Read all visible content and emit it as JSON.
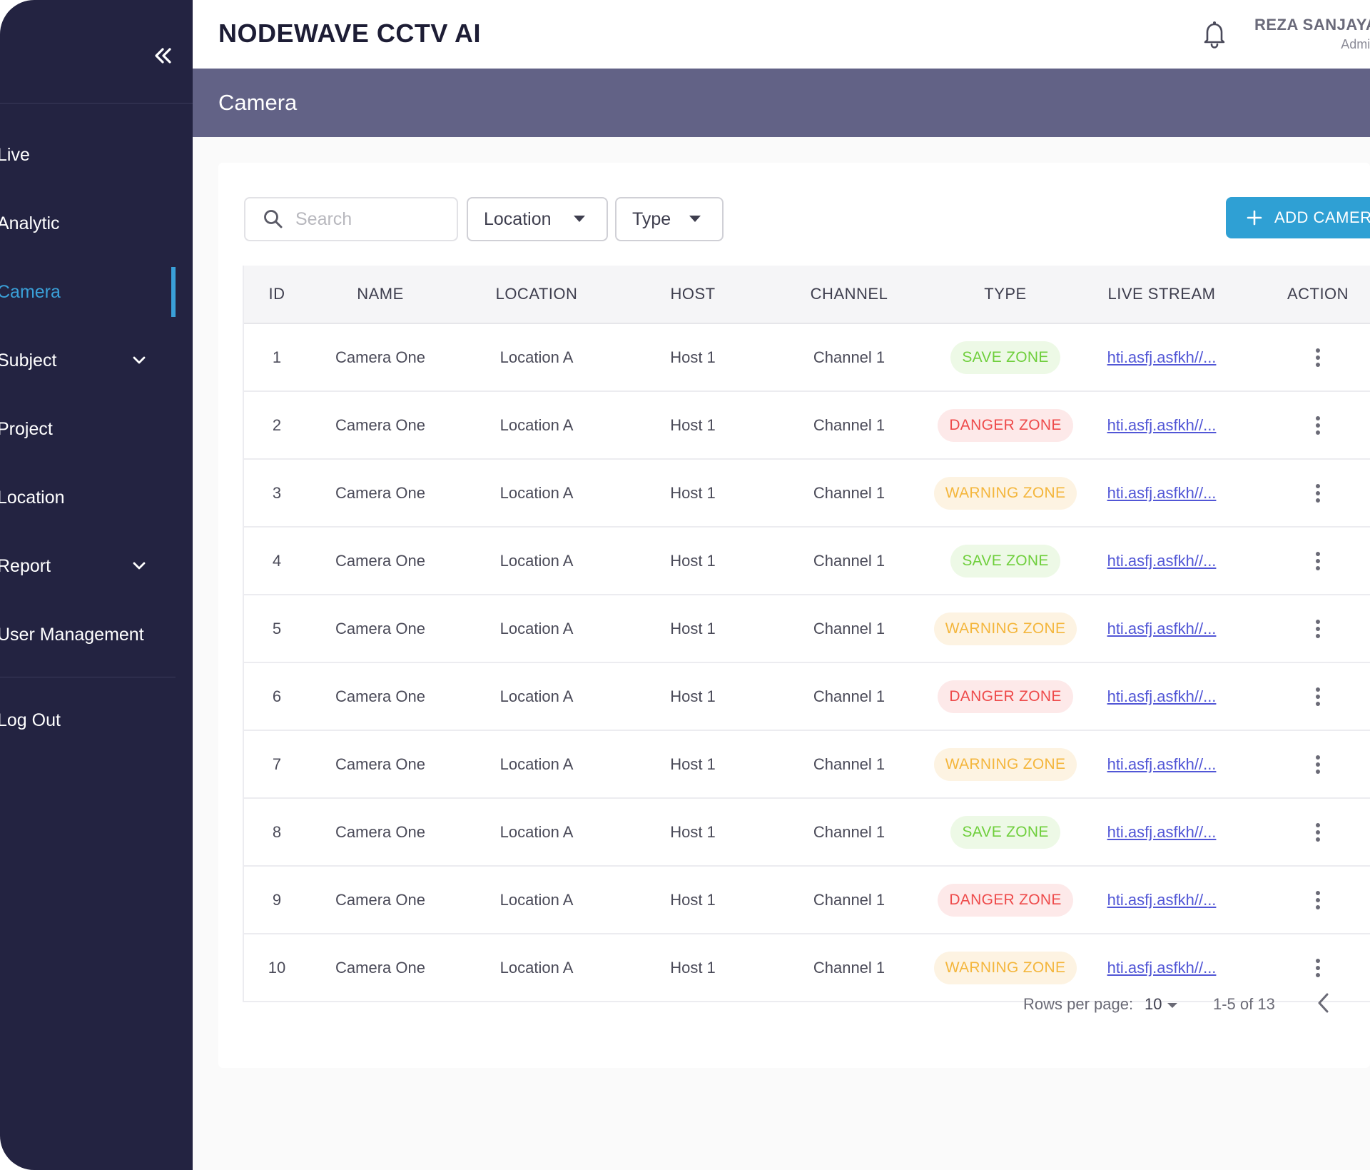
{
  "app": {
    "title": "NODEWAVE CCTV AI"
  },
  "user": {
    "name": "REZA SANJAYA",
    "role": "Admin"
  },
  "page": {
    "title": "Camera"
  },
  "sidebar": {
    "items": [
      {
        "label": "Live"
      },
      {
        "label": "Analytic"
      },
      {
        "label": "Camera",
        "active": true
      },
      {
        "label": "Subject",
        "has_submenu": true
      },
      {
        "label": "Project"
      },
      {
        "label": "Location"
      },
      {
        "label": "Report",
        "has_submenu": true
      },
      {
        "label": "User Management"
      }
    ],
    "logout": "Log Out"
  },
  "toolbar": {
    "search_placeholder": "Search",
    "location_filter": "Location",
    "type_filter": "Type",
    "add_button": "ADD CAMER"
  },
  "table": {
    "headers": [
      "ID",
      "NAME",
      "LOCATION",
      "HOST",
      "CHANNEL",
      "TYPE",
      "LIVE STREAM",
      "ACTION"
    ],
    "rows": [
      {
        "id": "1",
        "name": "Camera One",
        "location": "Location A",
        "host": "Host 1",
        "channel": "Channel 1",
        "type": "SAVE ZONE",
        "type_kind": "save",
        "stream": "hti.asfj.asfkh//..."
      },
      {
        "id": "2",
        "name": "Camera One",
        "location": "Location A",
        "host": "Host 1",
        "channel": "Channel 1",
        "type": "DANGER ZONE",
        "type_kind": "danger",
        "stream": "hti.asfj.asfkh//..."
      },
      {
        "id": "3",
        "name": "Camera One",
        "location": "Location A",
        "host": "Host 1",
        "channel": "Channel 1",
        "type": "WARNING ZONE",
        "type_kind": "warning",
        "stream": "hti.asfj.asfkh//..."
      },
      {
        "id": "4",
        "name": "Camera One",
        "location": "Location A",
        "host": "Host 1",
        "channel": "Channel 1",
        "type": "SAVE ZONE",
        "type_kind": "save",
        "stream": "hti.asfj.asfkh//..."
      },
      {
        "id": "5",
        "name": "Camera One",
        "location": "Location A",
        "host": "Host 1",
        "channel": "Channel 1",
        "type": "WARNING ZONE",
        "type_kind": "warning",
        "stream": "hti.asfj.asfkh//..."
      },
      {
        "id": "6",
        "name": "Camera One",
        "location": "Location A",
        "host": "Host 1",
        "channel": "Channel 1",
        "type": "DANGER ZONE",
        "type_kind": "danger",
        "stream": "hti.asfj.asfkh//..."
      },
      {
        "id": "7",
        "name": "Camera One",
        "location": "Location A",
        "host": "Host 1",
        "channel": "Channel 1",
        "type": "WARNING ZONE",
        "type_kind": "warning",
        "stream": "hti.asfj.asfkh//..."
      },
      {
        "id": "8",
        "name": "Camera One",
        "location": "Location A",
        "host": "Host 1",
        "channel": "Channel 1",
        "type": "SAVE ZONE",
        "type_kind": "save",
        "stream": "hti.asfj.asfkh//..."
      },
      {
        "id": "9",
        "name": "Camera One",
        "location": "Location A",
        "host": "Host 1",
        "channel": "Channel 1",
        "type": "DANGER ZONE",
        "type_kind": "danger",
        "stream": "hti.asfj.asfkh//..."
      },
      {
        "id": "10",
        "name": "Camera One",
        "location": "Location A",
        "host": "Host 1",
        "channel": "Channel 1",
        "type": "WARNING ZONE",
        "type_kind": "warning",
        "stream": "hti.asfj.asfkh//..."
      }
    ]
  },
  "pagination": {
    "rows_per_page_label": "Rows per page:",
    "rows_per_page": "10",
    "range": "1-5 of 13"
  },
  "colors": {
    "sidebar_bg": "#232341",
    "banner_bg": "#626286",
    "accent": "#3aa0d8",
    "add_button": "#2fa0d4",
    "save_zone": "#6fcf3c",
    "danger_zone": "#ee4a4a",
    "warning_zone": "#f4b63c",
    "link": "#5156d6"
  }
}
